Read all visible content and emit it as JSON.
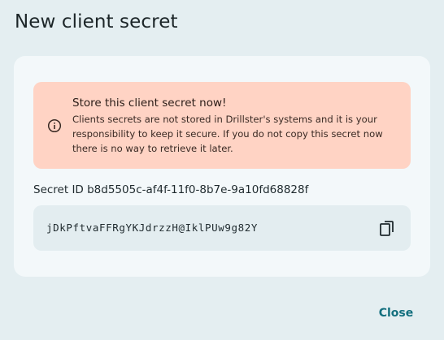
{
  "dialog": {
    "title": "New client secret"
  },
  "alert": {
    "icon": "info-icon",
    "title": "Store this client secret now!",
    "body": "Clients secrets are not stored in Drillster's systems and it is your responsibility to keep it secure. If you do not copy this secret now there is no way to retrieve it later.",
    "background": "#ffd3c4"
  },
  "secret": {
    "id_label": "Secret ID b8d5505c-af4f-11f0-8b7e-9a10fd68828f",
    "value": "jDkPftvaFFRgYKJdrzzH@IklPUw9g82Y",
    "copy_icon": "copy-icon"
  },
  "actions": {
    "close_label": "Close",
    "accent": "#136f7e"
  }
}
